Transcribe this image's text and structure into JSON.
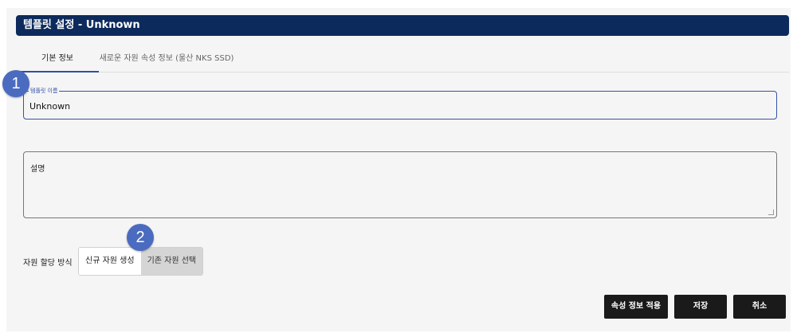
{
  "header": {
    "title": "템플릿 설정 - Unknown"
  },
  "tabs": [
    {
      "label": "기본 정보"
    },
    {
      "label": "새로운 자원 속성 정보 (울산 NKS SSD)"
    }
  ],
  "form": {
    "template_name": {
      "label": "템플릿 이름",
      "value": "Unknown"
    },
    "description": {
      "label": "설명",
      "value": ""
    }
  },
  "allocation": {
    "label": "자원 할당 방식",
    "options": [
      {
        "label": "신규 자원 생성",
        "selected": true
      },
      {
        "label": "기존 자원 선택",
        "selected": false
      }
    ]
  },
  "markers": [
    "1",
    "2"
  ],
  "buttons": {
    "apply": "속성 정보 적용",
    "save": "저장",
    "cancel": "취소"
  },
  "colors": {
    "header_bg": "#0d2a5c",
    "accent": "#3552a8",
    "marker": "#4a6bbf",
    "button_bg": "#1a1a1a"
  }
}
